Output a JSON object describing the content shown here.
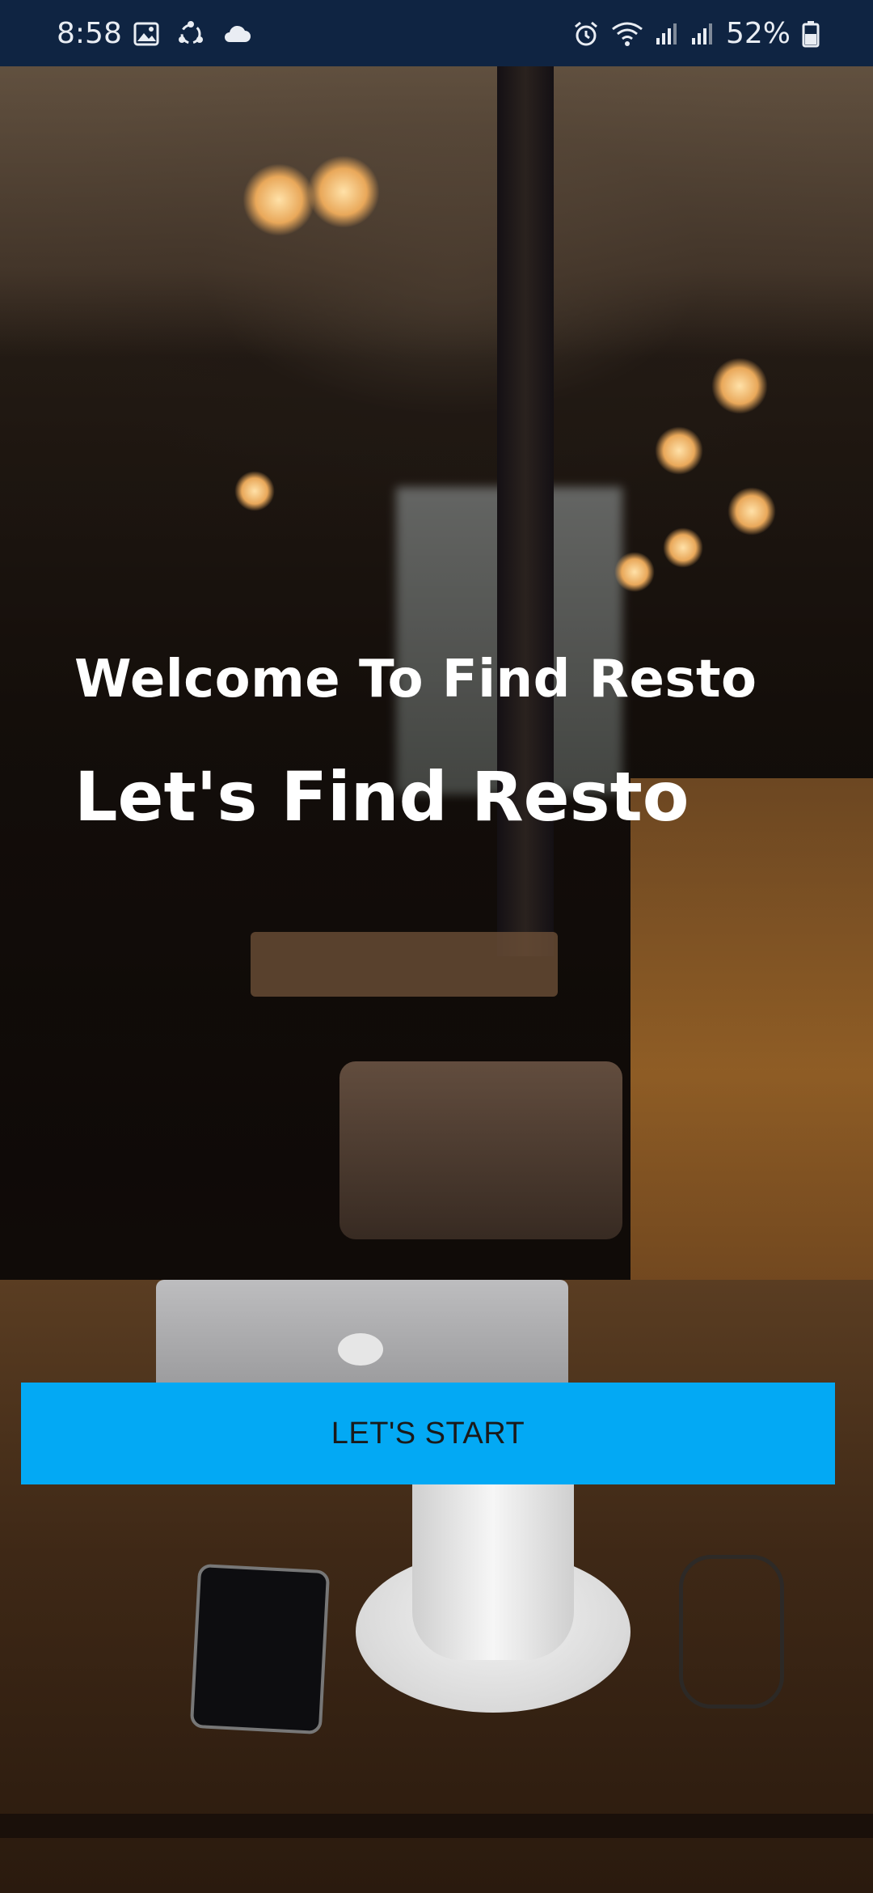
{
  "status_bar": {
    "time": "8:58",
    "battery_percent": "52%",
    "left_icons": [
      "gallery-icon",
      "sync-icon",
      "cloud-icon"
    ],
    "right_icons": [
      "alarm-icon",
      "wifi-icon",
      "signal-icon",
      "signal-icon",
      "battery-icon"
    ]
  },
  "main": {
    "welcome_text": "Welcome To Find Resto",
    "title_text": "Let's Find Resto",
    "start_button_label": "LET'S START"
  },
  "colors": {
    "status_bar_bg": "#0f2442",
    "button_bg": "#03a9f4",
    "button_text": "#1a1a1a",
    "heading_text": "#ffffff"
  }
}
